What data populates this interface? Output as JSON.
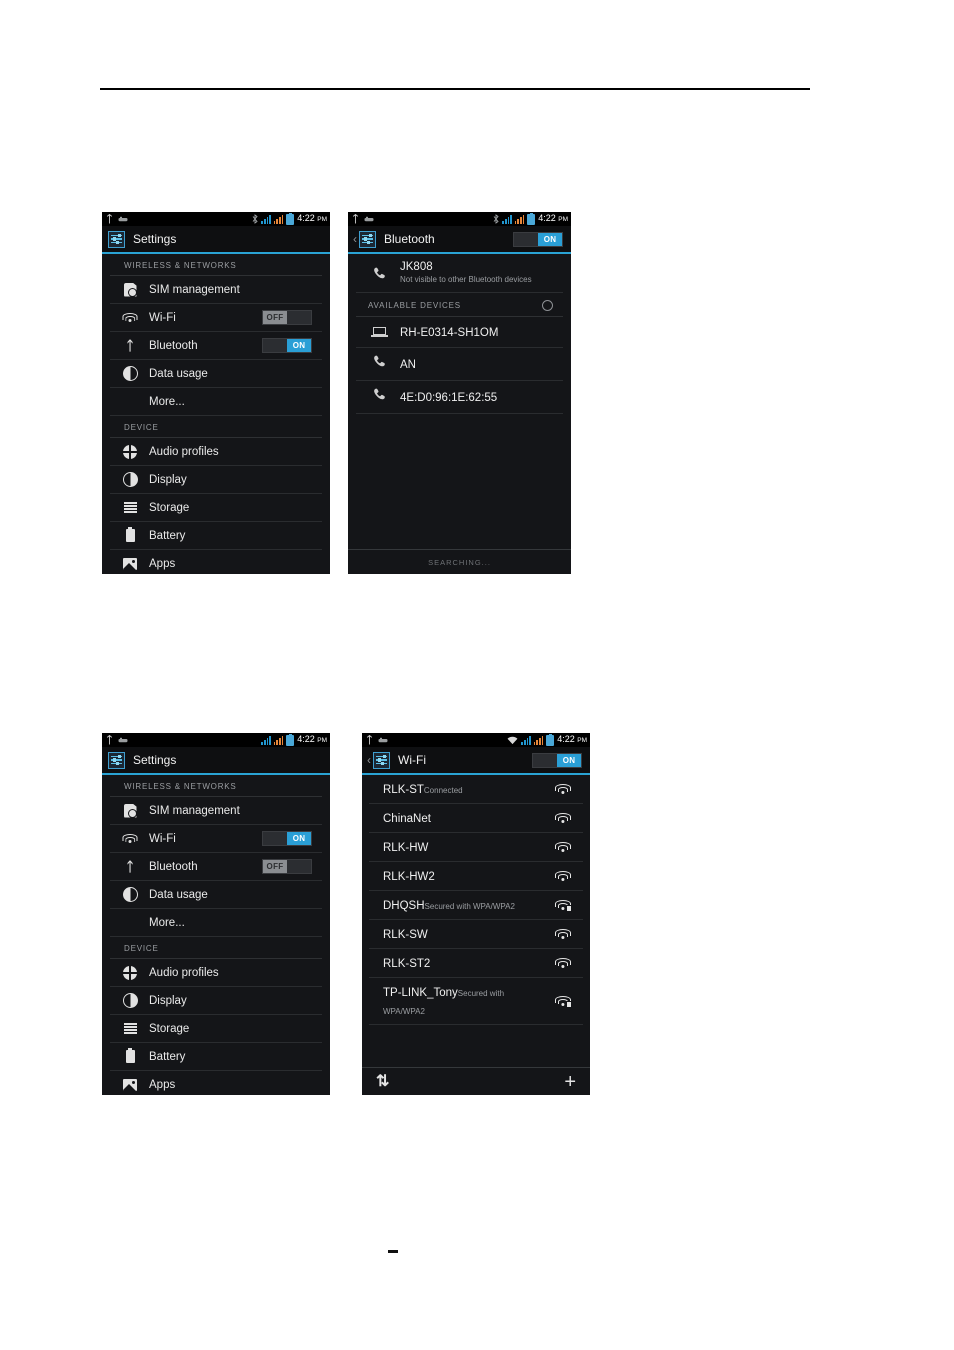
{
  "page": {
    "rule": "horizontal-rule",
    "footer_mark": "-"
  },
  "status_bar": {
    "time": "4:22",
    "ampm": "PM",
    "icons_left": [
      "usb-icon",
      "usb-debug-icon"
    ],
    "icons_right_bluetooth_screen": [
      "bluetooth-icon",
      "signal-bars-blue",
      "signal-bars-orange",
      "battery-icon"
    ],
    "icons_right_wifi_screen": [
      "wifi-icon",
      "signal-bars-blue",
      "signal-bars-orange",
      "battery-icon"
    ]
  },
  "colors": {
    "accent": "#2aa3d4",
    "panel_bg": "#141518",
    "statusbar_bg": "#000000",
    "toggle_on": "#2a9fd6",
    "toggle_off_thumb": "#8a8d91",
    "signal_blue": "#2196cf",
    "signal_orange": "#e8873a"
  },
  "settings_panel_1": {
    "title": "Settings",
    "app_icon": "settings-icon",
    "sections": [
      {
        "header": "WIRELESS & NETWORKS",
        "rows": [
          {
            "icon": "sim-card-icon",
            "label": "SIM management",
            "toggle": null
          },
          {
            "icon": "wifi-icon",
            "label": "Wi-Fi",
            "toggle": {
              "state": "off",
              "label": "OFF"
            }
          },
          {
            "icon": "bluetooth-icon",
            "label": "Bluetooth",
            "toggle": {
              "state": "on",
              "label": "ON"
            }
          },
          {
            "icon": "data-usage-icon",
            "label": "Data usage",
            "toggle": null
          },
          {
            "icon": null,
            "label": "More...",
            "toggle": null
          }
        ]
      },
      {
        "header": "DEVICE",
        "rows": [
          {
            "icon": "audio-profiles-icon",
            "label": "Audio profiles",
            "toggle": null
          },
          {
            "icon": "display-icon",
            "label": "Display",
            "toggle": null
          },
          {
            "icon": "storage-icon",
            "label": "Storage",
            "toggle": null
          },
          {
            "icon": "battery-icon",
            "label": "Battery",
            "toggle": null
          },
          {
            "icon": "apps-icon",
            "label": "Apps",
            "toggle": null
          }
        ]
      }
    ]
  },
  "bluetooth_panel": {
    "title": "Bluetooth",
    "back_icon": "back-caret-icon",
    "app_icon": "settings-icon",
    "toggle": {
      "state": "on",
      "label": "ON"
    },
    "own_device": {
      "icon": "phone-icon",
      "name": "JK808",
      "subtitle": "Not visible to other Bluetooth devices"
    },
    "available_header": "AVAILABLE DEVICES",
    "scanning_spinner": "spinner-icon",
    "devices": [
      {
        "icon": "laptop-icon",
        "name": "RH-E0314-SH1OM"
      },
      {
        "icon": "phone-icon",
        "name": "AN"
      },
      {
        "icon": "phone-icon",
        "name": "4E:D0:96:1E:62:55"
      }
    ],
    "footer": "SEARCHING..."
  },
  "settings_panel_2": {
    "title": "Settings",
    "app_icon": "settings-icon",
    "sections": [
      {
        "header": "WIRELESS & NETWORKS",
        "rows": [
          {
            "icon": "sim-card-icon",
            "label": "SIM management",
            "toggle": null
          },
          {
            "icon": "wifi-icon",
            "label": "Wi-Fi",
            "toggle": {
              "state": "on",
              "label": "ON"
            }
          },
          {
            "icon": "bluetooth-icon",
            "label": "Bluetooth",
            "toggle": {
              "state": "off",
              "label": "OFF"
            }
          },
          {
            "icon": "data-usage-icon",
            "label": "Data usage",
            "toggle": null
          },
          {
            "icon": null,
            "label": "More...",
            "toggle": null
          }
        ]
      },
      {
        "header": "DEVICE",
        "rows": [
          {
            "icon": "audio-profiles-icon",
            "label": "Audio profiles",
            "toggle": null
          },
          {
            "icon": "display-icon",
            "label": "Display",
            "toggle": null
          },
          {
            "icon": "storage-icon",
            "label": "Storage",
            "toggle": null
          },
          {
            "icon": "battery-icon",
            "label": "Battery",
            "toggle": null
          },
          {
            "icon": "apps-icon",
            "label": "Apps",
            "toggle": null
          }
        ]
      }
    ]
  },
  "wifi_panel": {
    "title": "Wi-Fi",
    "back_icon": "back-caret-icon",
    "app_icon": "settings-icon",
    "toggle": {
      "state": "on",
      "label": "ON"
    },
    "networks": [
      {
        "name": "RLK-ST",
        "sub": "Connected",
        "secured": false
      },
      {
        "name": "ChinaNet",
        "sub": "",
        "secured": false
      },
      {
        "name": "RLK-HW",
        "sub": "",
        "secured": false
      },
      {
        "name": "RLK-HW2",
        "sub": "",
        "secured": false
      },
      {
        "name": "DHQSH",
        "sub": "Secured with WPA/WPA2",
        "secured": true
      },
      {
        "name": "RLK-SW",
        "sub": "",
        "secured": false
      },
      {
        "name": "RLK-ST2",
        "sub": "",
        "secured": false
      },
      {
        "name": "TP-LINK_Tony",
        "sub": "Secured with WPA/WPA2",
        "secured": true
      }
    ],
    "bottom_bar": {
      "scan_icon": "refresh-scan-icon",
      "add_icon": "add-network-icon"
    }
  }
}
